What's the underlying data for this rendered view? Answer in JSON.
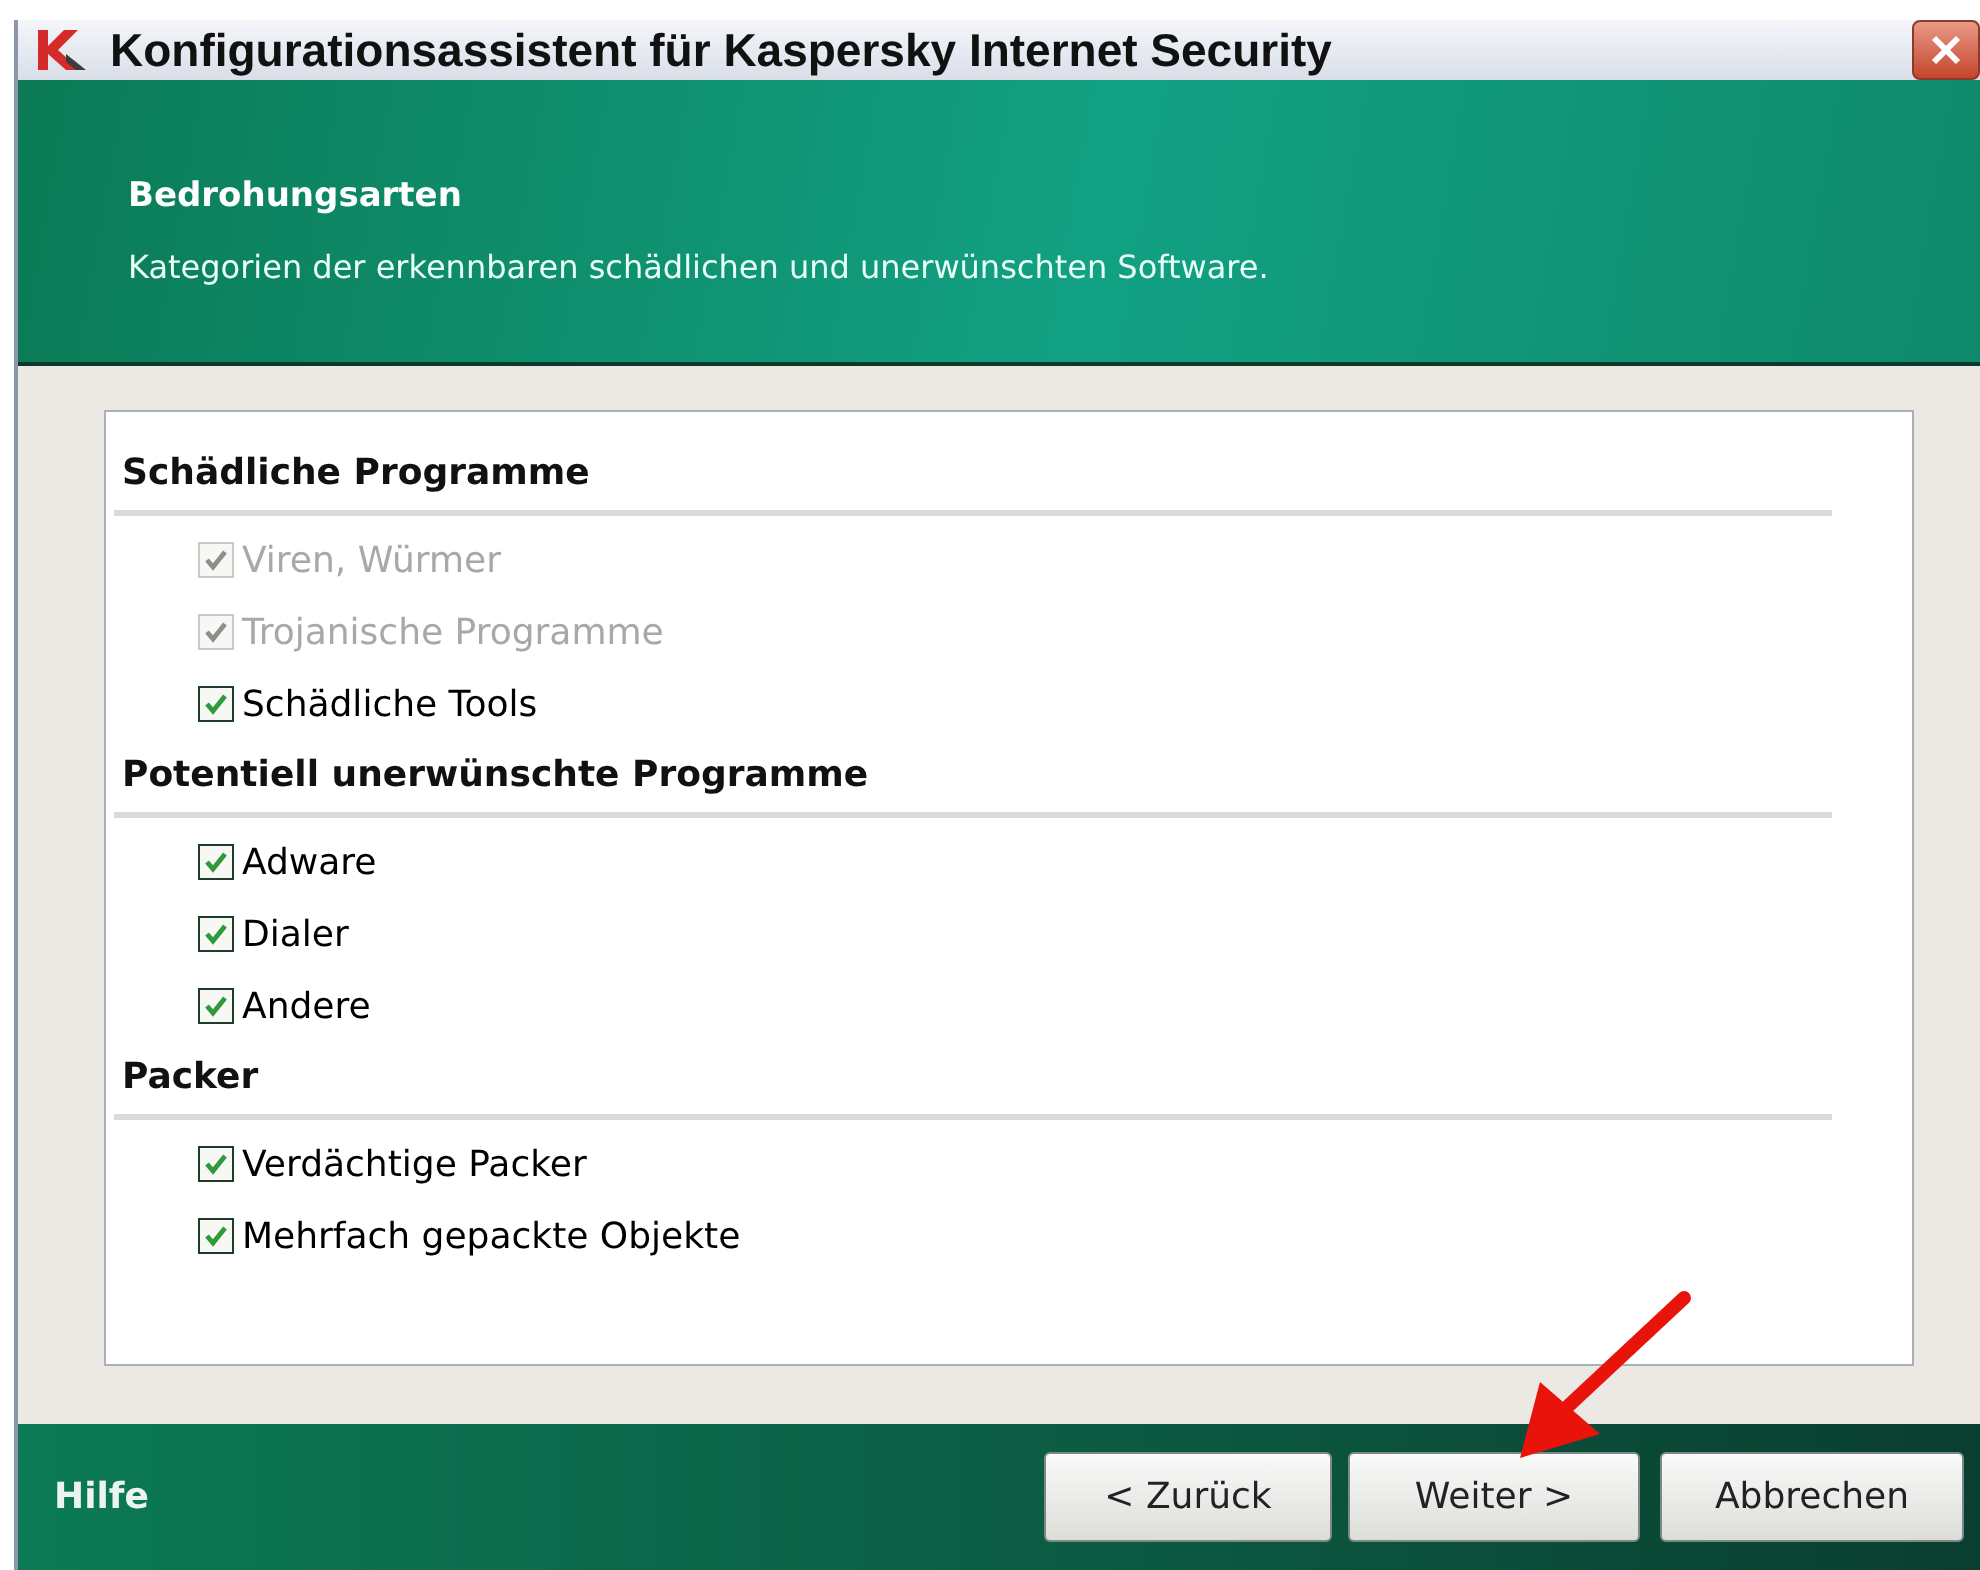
{
  "window": {
    "title": "Konfigurationsassistent für Kaspersky Internet Security"
  },
  "header": {
    "title": "Bedrohungsarten",
    "subtitle": "Kategorien der erkennbaren schädlichen und unerwünschten Software."
  },
  "groups": [
    {
      "title": "Schädliche Programme",
      "items": [
        {
          "label": "Viren, Würmer",
          "checked": true,
          "disabled": true
        },
        {
          "label": "Trojanische Programme",
          "checked": true,
          "disabled": true
        },
        {
          "label": "Schädliche Tools",
          "checked": true,
          "disabled": false
        }
      ]
    },
    {
      "title": "Potentiell unerwünschte Programme",
      "items": [
        {
          "label": "Adware",
          "checked": true,
          "disabled": false
        },
        {
          "label": "Dialer",
          "checked": true,
          "disabled": false
        },
        {
          "label": "Andere",
          "checked": true,
          "disabled": false
        }
      ]
    },
    {
      "title": "Packer",
      "items": [
        {
          "label": "Verdächtige Packer",
          "checked": true,
          "disabled": false
        },
        {
          "label": "Mehrfach gepackte Objekte",
          "checked": true,
          "disabled": false
        }
      ]
    }
  ],
  "footer": {
    "help": "Hilfe",
    "buttons": [
      "< Zurück",
      "Weiter >",
      "Abbrechen"
    ]
  }
}
